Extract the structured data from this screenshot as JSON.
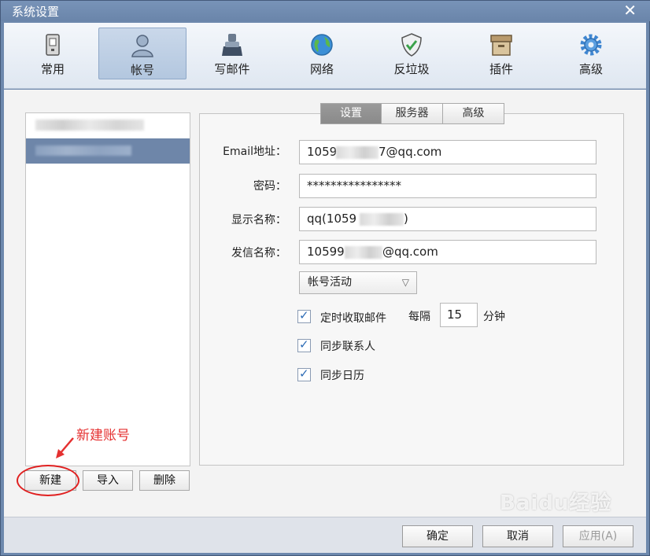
{
  "window": {
    "title": "系统设置",
    "close_glyph": "✕"
  },
  "toolbar": {
    "items": [
      {
        "label": "常用",
        "icon": "phone-icon"
      },
      {
        "label": "帐号",
        "icon": "user-icon",
        "active": true
      },
      {
        "label": "写邮件",
        "icon": "compose-icon"
      },
      {
        "label": "网络",
        "icon": "globe-icon"
      },
      {
        "label": "反垃圾",
        "icon": "shield-icon"
      },
      {
        "label": "插件",
        "icon": "box-icon"
      },
      {
        "label": "高级",
        "icon": "gear-icon"
      }
    ]
  },
  "account_list": {
    "buttons": {
      "new": "新建",
      "import": "导入",
      "delete": "删除"
    }
  },
  "annotation": {
    "text": "新建账号",
    "color": "#e53030"
  },
  "tabs": [
    "设置",
    "服务器",
    "高级"
  ],
  "form": {
    "email_label": "Email地址：",
    "email_value_prefix": "1059",
    "email_value_suffix": "7@qq.com",
    "password_label": "密码：",
    "password_value": "****************",
    "display_name_label": "显示名称：",
    "display_name_prefix": "qq(1059",
    "display_name_suffix": ")",
    "sender_name_label": "发信名称：",
    "sender_name_prefix": "10599",
    "sender_name_suffix": "@qq.com",
    "status_select": "帐号活动",
    "auto_fetch_label": "定时收取邮件",
    "every_label": "每隔",
    "interval_value": "15",
    "minutes_label": "分钟",
    "sync_contacts_label": "同步联系人",
    "sync_calendar_label": "同步日历"
  },
  "footer": {
    "ok": "确定",
    "cancel": "取消",
    "apply": "应用(A)"
  },
  "watermark": "Baidu经验",
  "colors": {
    "accent": "#2d6bb5",
    "selection": "#6e86a9",
    "titlebar": "#6a85aa"
  }
}
